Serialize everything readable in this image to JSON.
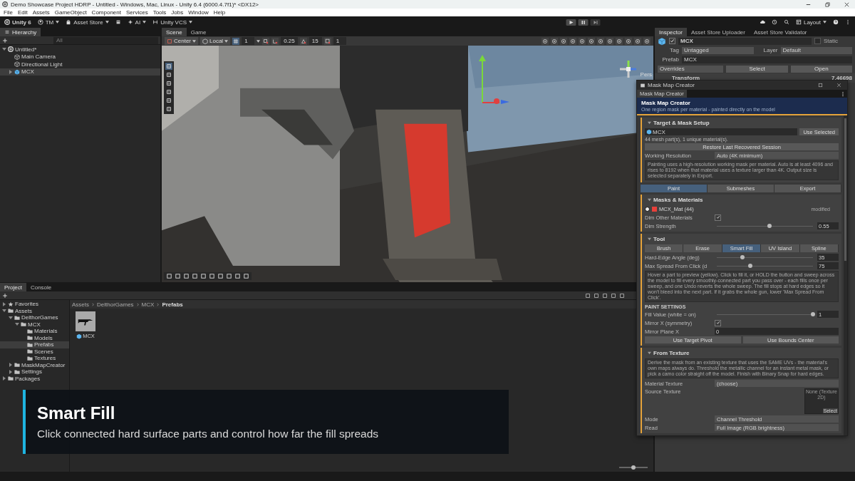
{
  "window": {
    "title": "Demo Showcase Project HDRP - Untitled - Windows, Mac, Linux - Unity 6.4 (6000.4.7f1)* <DX12>"
  },
  "menu": [
    "File",
    "Edit",
    "Assets",
    "GameObject",
    "Component",
    "Services",
    "Tools",
    "Jobs",
    "Window",
    "Help"
  ],
  "toolbar": {
    "account": "Unity 6",
    "user": "TM",
    "asset_store": "Asset Store",
    "ai": "AI",
    "vcs": "Unity VCS",
    "layout": "Layout"
  },
  "hierarchy": {
    "tab": "Hierarchy",
    "search_placeholder": "All",
    "items": [
      {
        "label": "Untitled*",
        "kind": "scene",
        "expanded": true,
        "selected": false,
        "children": [
          {
            "label": "Main Camera",
            "kind": "object",
            "selected": false
          },
          {
            "label": "Directional Light",
            "kind": "object",
            "selected": false
          },
          {
            "label": "MCX",
            "kind": "prefab",
            "expanded": false,
            "selected": true
          }
        ]
      }
    ]
  },
  "scene": {
    "tabs": [
      {
        "label": "Scene",
        "selected": true
      },
      {
        "label": "Game",
        "selected": false
      }
    ],
    "pivot": "Center",
    "space": "Local",
    "grid_size": "1",
    "move_snap": "0.25",
    "rotate_snap": "15",
    "scale_snap": "1",
    "view_label": "Pers"
  },
  "inspector": {
    "tabs": [
      {
        "label": "Inspector",
        "selected": true
      },
      {
        "label": "Asset Store Uploader",
        "selected": false
      },
      {
        "label": "Asset Store Validator",
        "selected": false
      }
    ],
    "object_name": "MCX",
    "active": true,
    "static_label": "Static",
    "static": false,
    "tag_label": "Tag",
    "tag": "Untagged",
    "layer_label": "Layer",
    "layer": "Default",
    "prefab_label": "Prefab",
    "prefab": "MCX",
    "overrides": "Overrides",
    "select": "Select",
    "open": "Open",
    "component": "Transform",
    "component_value": "7.46698"
  },
  "mask_map_creator": {
    "title": "Mask Map Creator",
    "tab": "Mask Map Creator",
    "heading": "Mask Map Creator",
    "subtitle": "One region mask per material - painted directly on the model",
    "target_setup": {
      "title": "Target & Mask Setup",
      "expanded": true,
      "target": "MCX",
      "use_selected": "Use Selected",
      "info": "44 mesh part(s), 1 unique material(s).",
      "restore": "Restore Last Recovered Session",
      "resolution_label": "Working Resolution",
      "resolution": "Auto (4K minimum)",
      "help": "Painting uses a high-resolution working mask per material. Auto is at least 4096 and rises to 8192 when that material uses a texture larger than 4K. Output size is selected separately in Export."
    },
    "modes": [
      {
        "label": "Paint",
        "selected": true
      },
      {
        "label": "Submeshes",
        "selected": false
      },
      {
        "label": "Export",
        "selected": false
      }
    ],
    "masks": {
      "title": "Masks & Materials",
      "expanded": true,
      "materials": [
        {
          "name": "MCX_Mat  (44)",
          "color": "#e8403a",
          "selected": true,
          "status": "modified"
        }
      ],
      "dim_label": "Dim Other Materials",
      "dim_other": true,
      "strength_label": "Dim Strength",
      "strength": {
        "level": 0.55,
        "reading": "0.55"
      }
    },
    "tool": {
      "title": "Tool",
      "expanded": true,
      "tools": [
        {
          "label": "Brush",
          "selected": false
        },
        {
          "label": "Erase",
          "selected": false
        },
        {
          "label": "Smart Fill",
          "selected": true
        },
        {
          "label": "UV Island",
          "selected": false
        },
        {
          "label": "Spline",
          "selected": false
        }
      ],
      "sliders": [
        {
          "label": "Hard-Edge Angle (deg)",
          "level": 0.27,
          "reading": "35"
        },
        {
          "label": "Max Spread From Click (d",
          "level": 0.35,
          "reading": "75"
        }
      ],
      "help": "Hover a part to preview (yellow). Click to fill it, or HOLD the button and sweep across the model to fill every smoothly-connected part you pass over - each fills once per sweep, and one Undo reverts the whole sweep. The fill stops at hard edges so it won't bleed into the next part. If it grabs the whole gun, lower 'Max Spread From Click'.",
      "settings_title": "PAINT SETTINGS",
      "fill": {
        "label": "Fill Value (white = on)",
        "level": 1,
        "reading": "1"
      },
      "mirror_label": "Mirror X (symmetry)",
      "mirror": true,
      "plane_label": "Mirror Plane X",
      "plane": "0",
      "pivot_button": "Use Target Pivot",
      "bounds_button": "Use Bounds Center"
    },
    "from_texture": {
      "title": "From Texture",
      "expanded": true,
      "help": "Derive the mask from an existing texture that uses the SAME UVs - the material's own maps always do. Threshold the metallic channel for an instant metal mask, or pick a camo color straight off the model. Finish with Binary Snap for hard edges.",
      "material_label": "Material Texture",
      "material": "(choose)",
      "source_label": "Source Texture",
      "source": "None (Texture 2D)",
      "source_select": "Select",
      "mode_label": "Mode",
      "mode": "Channel Threshold",
      "read_label": "Read",
      "read": "Full Image (RGB brightness)"
    }
  },
  "project": {
    "tabs": [
      {
        "label": "Project",
        "selected": true
      },
      {
        "label": "Console",
        "selected": false
      }
    ],
    "tree": [
      {
        "label": "Favorites",
        "kind": "favorites",
        "expanded": false,
        "selected": false
      },
      {
        "label": "Assets",
        "kind": "folder",
        "expanded": true,
        "selected": false,
        "children": [
          {
            "label": "DelthorGames",
            "kind": "folder",
            "expanded": true,
            "selected": false,
            "children": [
              {
                "label": "MCX",
                "kind": "folder",
                "expanded": true,
                "selected": false,
                "children": [
                  {
                    "label": "Materials",
                    "kind": "folder",
                    "selected": false
                  },
                  {
                    "label": "Models",
                    "kind": "folder",
                    "selected": false
                  },
                  {
                    "label": "Prefabs",
                    "kind": "folder",
                    "selected": true
                  },
                  {
                    "label": "Scenes",
                    "kind": "folder",
                    "selected": false
                  },
                  {
                    "label": "Textures",
                    "kind": "folder",
                    "selected": false
                  }
                ]
              }
            ]
          },
          {
            "label": "MaskMapCreator",
            "kind": "folder",
            "expanded": false,
            "selected": false
          },
          {
            "label": "Settings",
            "kind": "folder",
            "expanded": false,
            "selected": false
          }
        ]
      },
      {
        "label": "Packages",
        "kind": "folder",
        "expanded": false,
        "selected": false
      }
    ],
    "breadcrumb": [
      "Assets",
      "DelthorGames",
      "MCX",
      "Prefabs"
    ],
    "assets": [
      {
        "label": "MCX",
        "kind": "prefab"
      }
    ],
    "icon_size": {
      "level": 0.5
    }
  },
  "caption": {
    "title": "Smart Fill",
    "text": "Click connected hard surface parts and control how far the fill spreads"
  }
}
